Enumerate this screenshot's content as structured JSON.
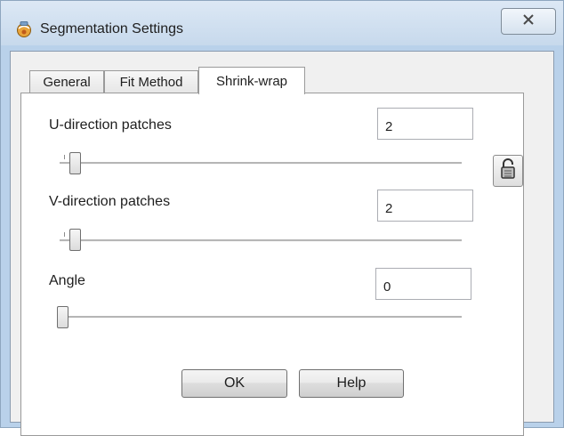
{
  "window": {
    "title": "Segmentation Settings",
    "close_glyph": "✕",
    "app_icon": "globe-app-icon"
  },
  "tabs": [
    {
      "label": "General",
      "active": false
    },
    {
      "label": "Fit Method",
      "active": false
    },
    {
      "label": "Shrink-wrap",
      "active": true
    }
  ],
  "fields": {
    "u_patches": {
      "label": "U-direction patches",
      "value": "2",
      "slider_value": 2
    },
    "v_patches": {
      "label": "V-direction patches",
      "value": "2",
      "slider_value": 2
    },
    "angle": {
      "label": "Angle",
      "value": "0",
      "slider_value": 0
    }
  },
  "lock_button": {
    "icon": "lock-icon"
  },
  "buttons": {
    "ok_label": "OK",
    "help_label": "Help"
  }
}
